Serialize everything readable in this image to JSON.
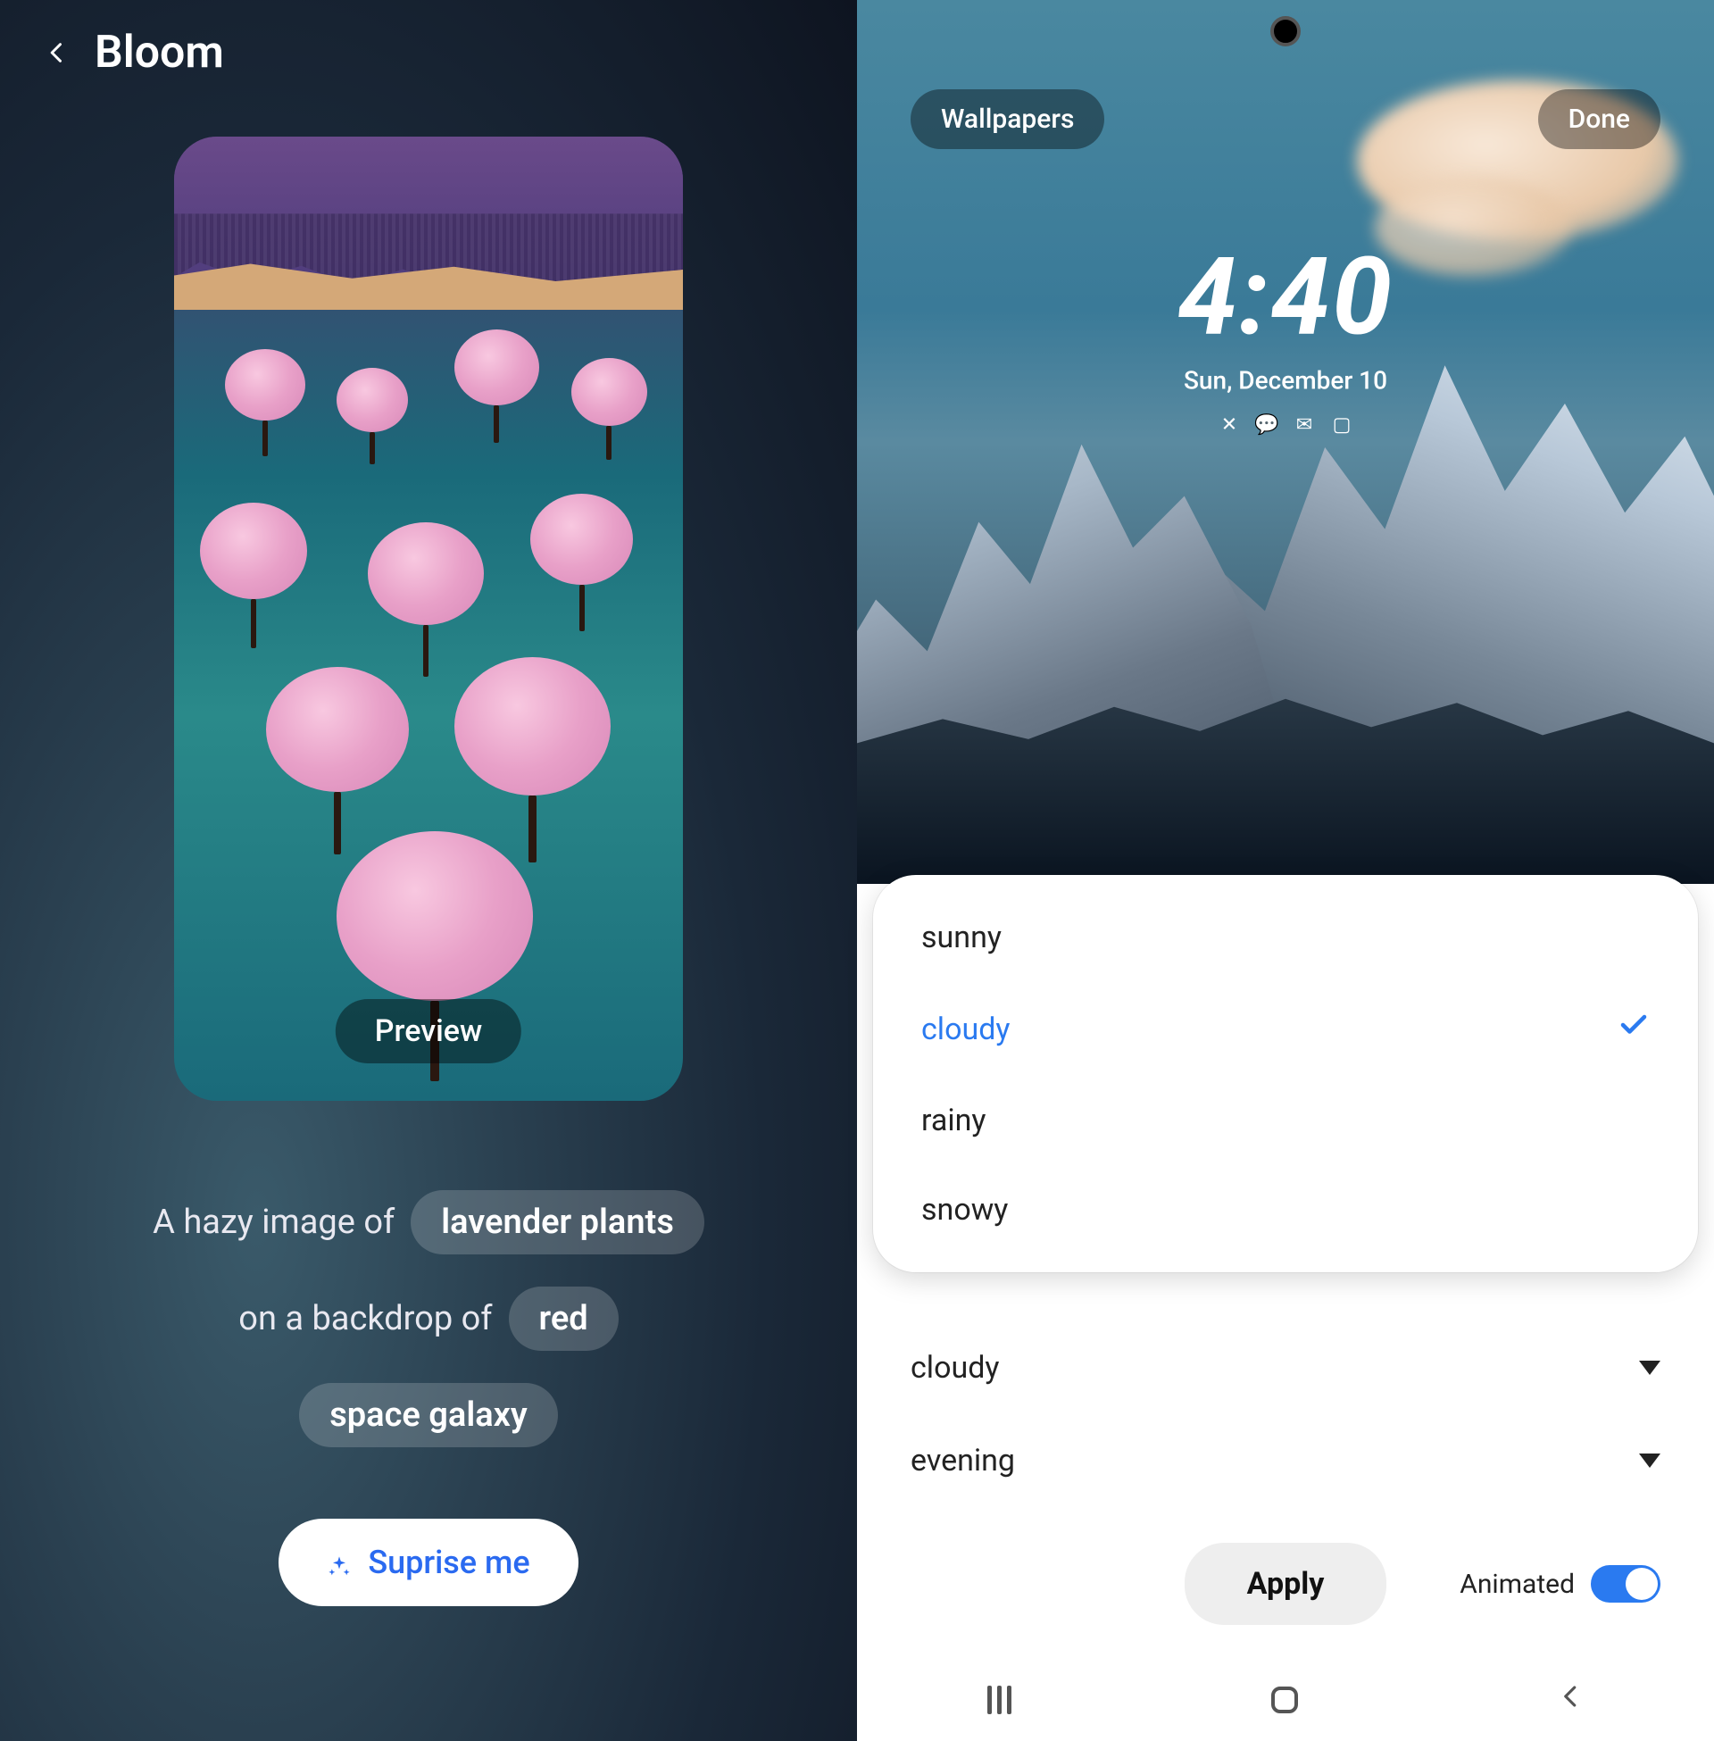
{
  "left": {
    "title": "Bloom",
    "preview_label": "Preview",
    "prompt": {
      "line1_prefix": "A hazy image of",
      "chip1": "lavender plants",
      "line2_prefix": "on a backdrop of",
      "chip2": "red",
      "chip3": "space galaxy"
    },
    "surprise_label": "Suprise me"
  },
  "right": {
    "topbar": {
      "wallpapers": "Wallpapers",
      "done": "Done"
    },
    "clock": {
      "time": "4:40",
      "date": "Sun, December 10"
    },
    "weather_options": [
      {
        "label": "sunny",
        "selected": false
      },
      {
        "label": "cloudy",
        "selected": true
      },
      {
        "label": "rainy",
        "selected": false
      },
      {
        "label": "snowy",
        "selected": false
      }
    ],
    "selects": {
      "row1": "cloudy",
      "row2": "evening"
    },
    "apply": "Apply",
    "animated_label": "Animated",
    "animated_on": true
  }
}
